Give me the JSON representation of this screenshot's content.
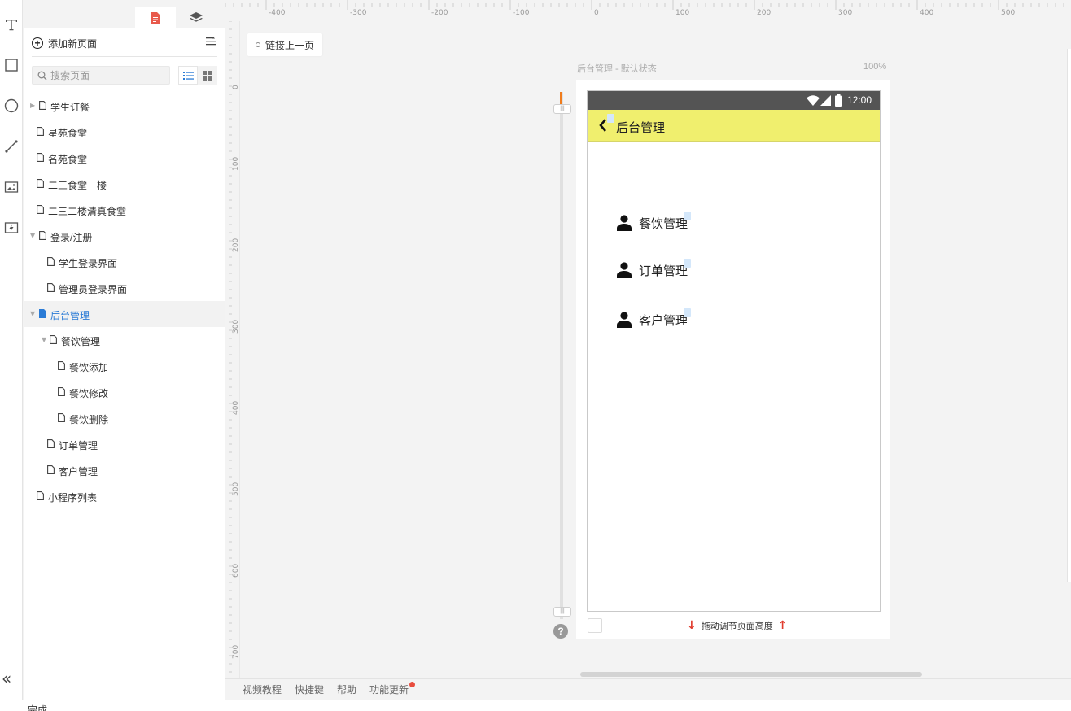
{
  "sidebar_panel": {
    "add_page_label": "添加新页面",
    "search_placeholder": "搜索页面"
  },
  "page_tree": [
    {
      "label": "学生订餐",
      "level": 0,
      "expander": "collapsed",
      "selected": false
    },
    {
      "label": "星苑食堂",
      "level": 0,
      "expander": "none",
      "selected": false
    },
    {
      "label": "名苑食堂",
      "level": 0,
      "expander": "none",
      "selected": false
    },
    {
      "label": "二三食堂一楼",
      "level": 0,
      "expander": "none",
      "selected": false
    },
    {
      "label": "二三二楼清真食堂",
      "level": 0,
      "expander": "none",
      "selected": false
    },
    {
      "label": "登录/注册",
      "level": 0,
      "expander": "expanded",
      "selected": false
    },
    {
      "label": "学生登录界面",
      "level": 1,
      "expander": "none",
      "selected": false
    },
    {
      "label": "管理员登录界面",
      "level": 1,
      "expander": "none",
      "selected": false
    },
    {
      "label": "后台管理",
      "level": 0,
      "expander": "expanded",
      "selected": true
    },
    {
      "label": "餐饮管理",
      "level": 1,
      "expander": "expanded",
      "selected": false
    },
    {
      "label": "餐饮添加",
      "level": 2,
      "expander": "none",
      "selected": false
    },
    {
      "label": "餐饮修改",
      "level": 2,
      "expander": "none",
      "selected": false
    },
    {
      "label": "餐饮删除",
      "level": 2,
      "expander": "none",
      "selected": false
    },
    {
      "label": "订单管理",
      "level": 1,
      "expander": "none",
      "selected": false
    },
    {
      "label": "客户管理",
      "level": 1,
      "expander": "none",
      "selected": false
    },
    {
      "label": "小程序列表",
      "level": 0,
      "expander": "none",
      "selected": false
    }
  ],
  "rulers": {
    "top": [
      "-400",
      "-300",
      "-200",
      "-100",
      "0",
      "100",
      "200",
      "300",
      "400",
      "500"
    ],
    "left": [
      "0",
      "100",
      "200",
      "300",
      "400",
      "500",
      "600",
      "700"
    ]
  },
  "canvas": {
    "link_prev_label": "链接上一页",
    "artboard_title": "后台管理 - 默认状态",
    "zoom": "100%",
    "drag_hint": "拖动调节页面高度",
    "help_label": "?"
  },
  "phone": {
    "time": "12:00",
    "nav_title": "后台管理",
    "menu": [
      {
        "label": "餐饮管理",
        "icon": "user-icon"
      },
      {
        "label": "订单管理",
        "icon": "user-icon"
      },
      {
        "label": "客户管理",
        "icon": "user-icon"
      }
    ]
  },
  "footer": {
    "links": [
      "视频教程",
      "快捷键",
      "帮助",
      "功能更新"
    ]
  },
  "status_text": "完成",
  "colors": {
    "accent": "#2a7bd6",
    "navbar": "#f0ef6e",
    "statusbar": "#545454",
    "slider_top": "#f07c1c",
    "alert_red": "#e84c3d"
  }
}
